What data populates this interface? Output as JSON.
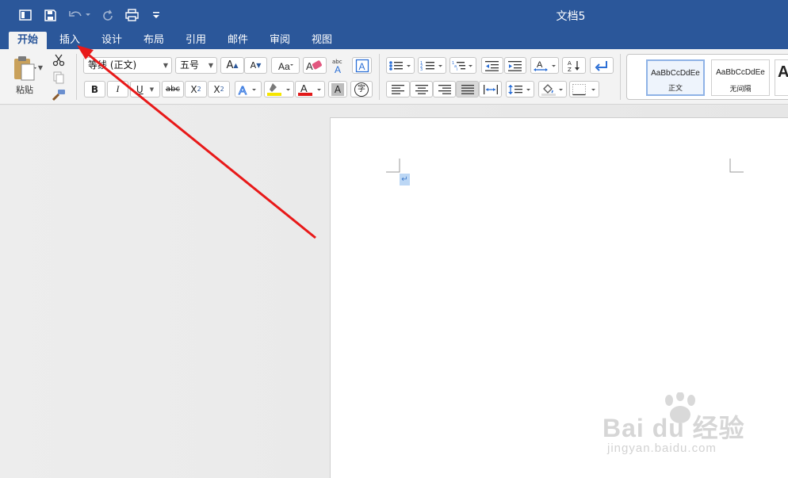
{
  "window": {
    "title": "文档5"
  },
  "tabs": [
    {
      "label": "开始",
      "active": true
    },
    {
      "label": "插入"
    },
    {
      "label": "设计"
    },
    {
      "label": "布局"
    },
    {
      "label": "引用"
    },
    {
      "label": "邮件"
    },
    {
      "label": "审阅"
    },
    {
      "label": "视图"
    }
  ],
  "clipboard": {
    "paste_label": "粘贴"
  },
  "font": {
    "name": "等线 (正文)",
    "size": "五号",
    "bold": "B",
    "italic": "I",
    "underline": "U",
    "strike": "abc",
    "subscript": "X",
    "sub_index": "2",
    "superscript": "X",
    "super_index": "2",
    "phonetic_top": "abc",
    "clear_letter": "A",
    "shading_letter": "A",
    "color_letter": "A",
    "char_border": "字",
    "highlight_color": "#f5e500",
    "font_color": "#e21a1a"
  },
  "styles": [
    {
      "sample": "AaBbCcDdEe",
      "name": "正文",
      "active": true
    },
    {
      "sample": "AaBbCcDdEe",
      "name": "无间隔"
    },
    {
      "sample": "A",
      "name": ""
    }
  ],
  "watermark": {
    "brand": "Bai du 经验",
    "url": "jingyan.baidu.com"
  },
  "annotation": {
    "arrow_color": "#e81919"
  },
  "colors": {
    "brand": "#2b579a",
    "ribbon": "#f3f3f3",
    "page": "#ffffff"
  }
}
